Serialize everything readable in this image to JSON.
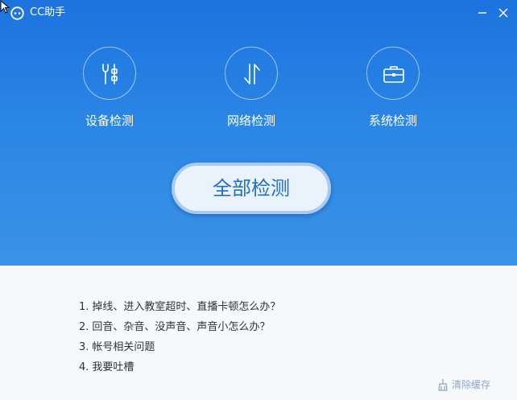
{
  "window": {
    "title": "CC助手",
    "minimize_icon": "minimize-icon",
    "close_icon": "close-icon"
  },
  "tools": [
    {
      "label": "设备检测",
      "icon": "wrench-settings-icon"
    },
    {
      "label": "网络检测",
      "icon": "network-arrows-icon"
    },
    {
      "label": "系统检测",
      "icon": "toolbox-icon"
    }
  ],
  "main_action": {
    "label": "全部检测"
  },
  "faq": [
    {
      "num": "1.",
      "text": "掉线、进入教室超时、直播卡顿怎么办？"
    },
    {
      "num": "2.",
      "text": "回音、杂音、没声音、声音小怎么办？"
    },
    {
      "num": "3.",
      "text": "帐号相关问题"
    },
    {
      "num": "4.",
      "text": "我要吐槽"
    }
  ],
  "footer": {
    "clear_cache_label": "清除缓存",
    "clear_cache_icon": "broom-icon"
  },
  "colors": {
    "header_top": "#1c73de",
    "header_bottom": "#3b93e6",
    "button_text": "#1d6fcf",
    "link_muted": "#8ea9c6"
  }
}
